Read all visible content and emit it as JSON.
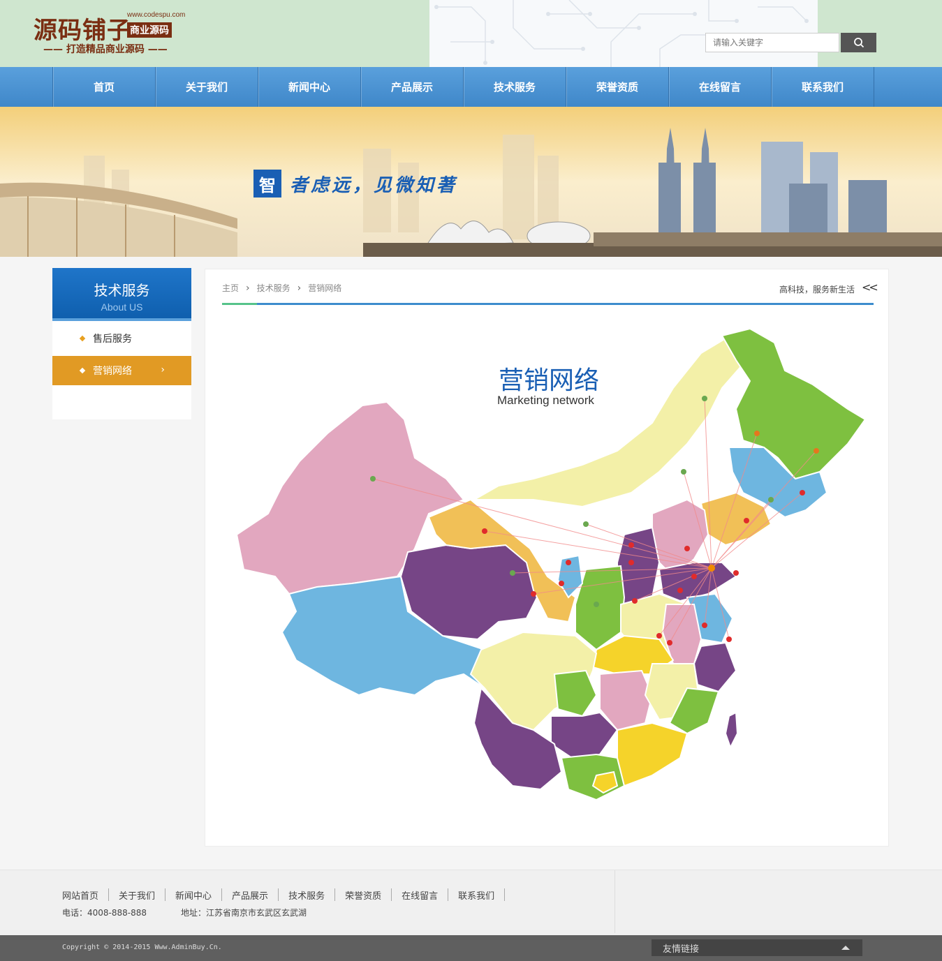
{
  "header": {
    "logo_main": "源码铺子",
    "logo_url": "www.codespu.com",
    "logo_tag": "商业源码",
    "logo_slogan": "—— 打造精品商业源码 ——",
    "search_placeholder": "请输入关键字"
  },
  "nav": {
    "items": [
      {
        "label": "首页"
      },
      {
        "label": "关于我们"
      },
      {
        "label": "新闻中心"
      },
      {
        "label": "产品展示"
      },
      {
        "label": "技术服务"
      },
      {
        "label": "荣誉资质"
      },
      {
        "label": "在线留言"
      },
      {
        "label": "联系我们"
      }
    ]
  },
  "banner": {
    "slogan_char": "智",
    "slogan_text": "者虑远，见微知著"
  },
  "sidebar": {
    "title": "技术服务",
    "subtitle": "About US",
    "items": [
      {
        "label": "售后服务"
      },
      {
        "label": "营销网络"
      }
    ],
    "active_index": 1
  },
  "breadcrumb": {
    "items": [
      "主页",
      "技术服务",
      "营销网络"
    ],
    "right_note": "高科技，服务新生活",
    "back_label": "<<"
  },
  "map": {
    "title": "营销网络",
    "subtitle": "Marketing network"
  },
  "footer": {
    "links": [
      "网站首页",
      "关于我们",
      "新闻中心",
      "产品展示",
      "技术服务",
      "荣誉资质",
      "在线留言",
      "联系我们"
    ],
    "tel": "电话：4008-888-888",
    "address": "地址：江苏省南京市玄武区玄武湖",
    "copyright": "Copyright © 2014-2015 Www.AdminBuy.Cn.",
    "friend_links": "友情链接"
  }
}
